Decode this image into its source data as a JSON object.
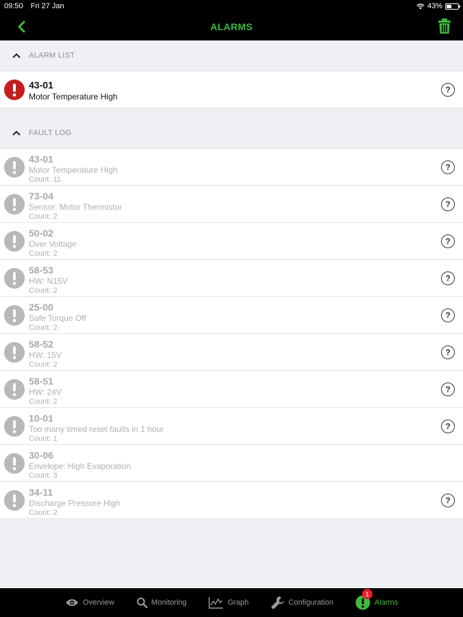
{
  "status_bar": {
    "time": "09:50",
    "date": "Fri 27 Jan",
    "battery": "43%",
    "battery_level": 0.43
  },
  "nav": {
    "title": "ALARMS",
    "back_icon": "chevron-left-icon",
    "trash_icon": "trash-icon"
  },
  "alarm_list": {
    "header": "ALARM LIST",
    "items": [
      {
        "code": "43-01",
        "description": "Motor Temperature High"
      }
    ]
  },
  "fault_log": {
    "header": "FAULT LOG",
    "items": [
      {
        "code": "43-01",
        "description": "Motor Temperature High",
        "count": "Count: 11",
        "help": true
      },
      {
        "code": "73-04",
        "description": "Sensor: Motor Thermistor",
        "count": "Count: 2",
        "help": true
      },
      {
        "code": "50-02",
        "description": "Over Voltage",
        "count": "Count: 2",
        "help": true
      },
      {
        "code": "58-53",
        "description": "HW: N15V",
        "count": "Count: 2",
        "help": true
      },
      {
        "code": "25-00",
        "description": "Safe Torque Off",
        "count": "Count: 2",
        "help": true
      },
      {
        "code": "58-52",
        "description": "HW: 15V",
        "count": "Count: 2",
        "help": true
      },
      {
        "code": "58-51",
        "description": "HW: 24V",
        "count": "Count: 2",
        "help": true
      },
      {
        "code": "10-01",
        "description": "Too many timed reset faults in 1 hour",
        "count": "Count: 1",
        "help": true
      },
      {
        "code": "30-06",
        "description": "Envelope: High Evaporation",
        "count": "Count: 3",
        "help": false
      },
      {
        "code": "34-11",
        "description": "Discharge Pressure High",
        "count": "Count: 2",
        "help": true
      }
    ]
  },
  "tabs": [
    {
      "label": "Overview",
      "icon": "eye-icon"
    },
    {
      "label": "Monitoring",
      "icon": "search-icon"
    },
    {
      "label": "Graph",
      "icon": "graph-icon"
    },
    {
      "label": "Configuration",
      "icon": "wrench-icon"
    },
    {
      "label": "Alarms",
      "icon": "alert-icon",
      "badge": "1",
      "active": true
    }
  ],
  "colors": {
    "accent": "#3dbb3d",
    "alarm_red": "#c41e1e",
    "badge_red": "#e8202a",
    "fault_grey": "#b8b8bc"
  }
}
